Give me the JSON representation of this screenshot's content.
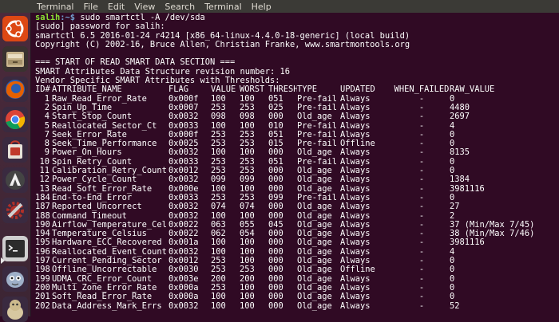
{
  "menu": [
    "Terminal",
    "File",
    "Edit",
    "View",
    "Search",
    "Terminal",
    "Help"
  ],
  "launcher": [
    {
      "name": "ubuntu-dash-icon",
      "color": "#dd4814"
    },
    {
      "name": "files-icon",
      "color": "#8b7a5c"
    },
    {
      "name": "firefox-icon",
      "color": "#e66000"
    },
    {
      "name": "chrome-icon",
      "color": "#4285f4"
    },
    {
      "name": "software-center-icon",
      "color": "#c0392b"
    },
    {
      "name": "software-updater-icon",
      "color": "#444444"
    },
    {
      "name": "system-settings-icon",
      "color": "#b03028"
    },
    {
      "name": "terminal-icon",
      "color": "#2c2c2c"
    },
    {
      "name": "gimp-icon",
      "color": "#6e86a8"
    },
    {
      "name": "pidgin-icon",
      "color": "#d7c7a0"
    }
  ],
  "terminal": {
    "prompt_user": "salih",
    "prompt_path": ":~$",
    "command": " sudo smartctl -A /dev/sda",
    "lines": [
      "[sudo] password for salih:",
      "smartctl 6.5 2016-01-24 r4214 [x86_64-linux-4.4.0-18-generic] (local build)",
      "Copyright (C) 2002-16, Bruce Allen, Christian Franke, www.smartmontools.org",
      "",
      "=== START OF READ SMART DATA SECTION ===",
      "SMART Attributes Data Structure revision number: 16",
      "Vendor Specific SMART Attributes with Thresholds:"
    ],
    "headers": [
      "ID#",
      "ATTRIBUTE_NAME",
      "FLAG",
      "VALUE",
      "WORST",
      "THRESH",
      "TYPE",
      "UPDATED",
      "WHEN_FAILED",
      "RAW_VALUE"
    ],
    "rows": [
      [
        "1",
        "Raw_Read_Error_Rate",
        "0x000f",
        "100",
        "100",
        "051",
        "Pre-fail",
        "Always",
        "-",
        "0"
      ],
      [
        "2",
        "Spin_Up_Time",
        "0x0007",
        "253",
        "253",
        "025",
        "Pre-fail",
        "Always",
        "-",
        "4480"
      ],
      [
        "4",
        "Start_Stop_Count",
        "0x0032",
        "098",
        "098",
        "000",
        "Old_age",
        "Always",
        "-",
        "2697"
      ],
      [
        "5",
        "Reallocated_Sector_Ct",
        "0x0033",
        "100",
        "100",
        "010",
        "Pre-fail",
        "Always",
        "-",
        "4"
      ],
      [
        "7",
        "Seek_Error_Rate",
        "0x000f",
        "253",
        "253",
        "051",
        "Pre-fail",
        "Always",
        "-",
        "0"
      ],
      [
        "8",
        "Seek_Time_Performance",
        "0x0025",
        "253",
        "253",
        "015",
        "Pre-fail",
        "Offline",
        "-",
        "0"
      ],
      [
        "9",
        "Power_On_Hours",
        "0x0032",
        "100",
        "100",
        "000",
        "Old_age",
        "Always",
        "-",
        "8135"
      ],
      [
        "10",
        "Spin_Retry_Count",
        "0x0033",
        "253",
        "253",
        "051",
        "Pre-fail",
        "Always",
        "-",
        "0"
      ],
      [
        "11",
        "Calibration_Retry_Count",
        "0x0012",
        "253",
        "253",
        "000",
        "Old_age",
        "Always",
        "-",
        "0"
      ],
      [
        "12",
        "Power_Cycle_Count",
        "0x0032",
        "099",
        "099",
        "000",
        "Old_age",
        "Always",
        "-",
        "1384"
      ],
      [
        "13",
        "Read_Soft_Error_Rate",
        "0x000e",
        "100",
        "100",
        "000",
        "Old_age",
        "Always",
        "-",
        "3981116"
      ],
      [
        "184",
        "End-to-End_Error",
        "0x0033",
        "253",
        "253",
        "099",
        "Pre-fail",
        "Always",
        "-",
        "0"
      ],
      [
        "187",
        "Reported_Uncorrect",
        "0x0032",
        "074",
        "074",
        "000",
        "Old_age",
        "Always",
        "-",
        "27"
      ],
      [
        "188",
        "Command_Timeout",
        "0x0032",
        "100",
        "100",
        "000",
        "Old_age",
        "Always",
        "-",
        "2"
      ],
      [
        "190",
        "Airflow_Temperature_Cel",
        "0x0022",
        "063",
        "055",
        "045",
        "Old_age",
        "Always",
        "-",
        "37 (Min/Max 7/45)"
      ],
      [
        "194",
        "Temperature_Celsius",
        "0x0022",
        "062",
        "054",
        "000",
        "Old_age",
        "Always",
        "-",
        "38 (Min/Max 7/46)"
      ],
      [
        "195",
        "Hardware_ECC_Recovered",
        "0x001a",
        "100",
        "100",
        "000",
        "Old_age",
        "Always",
        "-",
        "3981116"
      ],
      [
        "196",
        "Reallocated_Event_Count",
        "0x0032",
        "100",
        "100",
        "000",
        "Old_age",
        "Always",
        "-",
        "4"
      ],
      [
        "197",
        "Current_Pending_Sector",
        "0x0012",
        "253",
        "100",
        "000",
        "Old_age",
        "Always",
        "-",
        "0"
      ],
      [
        "198",
        "Offline_Uncorrectable",
        "0x0030",
        "253",
        "253",
        "000",
        "Old_age",
        "Offline",
        "-",
        "0"
      ],
      [
        "199",
        "UDMA_CRC_Error_Count",
        "0x003e",
        "200",
        "200",
        "000",
        "Old_age",
        "Always",
        "-",
        "0"
      ],
      [
        "200",
        "Multi_Zone_Error_Rate",
        "0x000a",
        "253",
        "100",
        "000",
        "Old_age",
        "Always",
        "-",
        "0"
      ],
      [
        "201",
        "Soft_Read_Error_Rate",
        "0x000a",
        "100",
        "100",
        "000",
        "Old_age",
        "Always",
        "-",
        "0"
      ],
      [
        "202",
        "Data_Address_Mark_Errs",
        "0x0032",
        "100",
        "100",
        "000",
        "Old_age",
        "Always",
        "-",
        "52"
      ]
    ]
  }
}
